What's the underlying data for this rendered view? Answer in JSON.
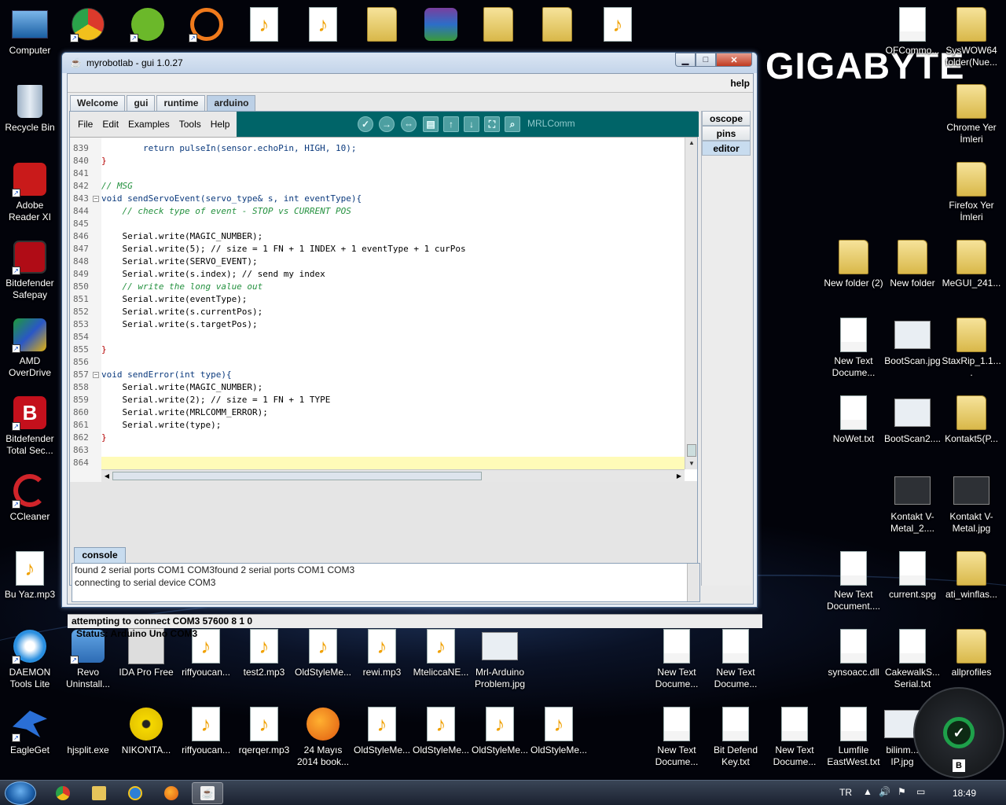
{
  "desktop": {
    "brand": "GIGABYTE",
    "icons_left": [
      {
        "label": "Computer",
        "glyph": "computer-icon"
      },
      {
        "label": "Recycle Bin",
        "glyph": "recycle-bin-icon"
      },
      {
        "label": "Adobe Reader XI",
        "glyph": "adobe-reader-icon"
      },
      {
        "label": "Bitdefender Safepay",
        "glyph": "bitdefender-safepay-icon"
      },
      {
        "label": "AMD OverDrive",
        "glyph": "amd-overdrive-icon"
      },
      {
        "label": "Bitdefender Total Sec...",
        "glyph": "bitdefender-icon"
      },
      {
        "label": "CCleaner",
        "glyph": "ccleaner-icon"
      },
      {
        "label": "Bu Yaz.mp3",
        "glyph": "mp3-icon"
      },
      {
        "label": "DAEMON Tools Lite",
        "glyph": "daemon-tools-icon"
      },
      {
        "label": "EagleGet",
        "glyph": "eagleget-icon"
      }
    ],
    "icons_bottom_row1": [
      {
        "label": "Revo Uninstall..."
      },
      {
        "label": "IDA Pro Free"
      },
      {
        "label": "riffyoucan..."
      },
      {
        "label": "test2.mp3"
      },
      {
        "label": "OldStyleMe..."
      },
      {
        "label": "rewi.mp3"
      },
      {
        "label": "MteliccaNE..."
      },
      {
        "label": "Mrl-Arduino Problem.jpg"
      }
    ],
    "icons_bottom_row2": [
      {
        "label": "hjsplit.exe"
      },
      {
        "label": "NIKONTA..."
      },
      {
        "label": "riffyoucan..."
      },
      {
        "label": "rqerqer.mp3"
      },
      {
        "label": "24 Mayıs 2014 book..."
      },
      {
        "label": "OldStyleMe..."
      },
      {
        "label": "OldStyleMe..."
      },
      {
        "label": "OldStyleMe..."
      },
      {
        "label": "OldStyleMe..."
      }
    ],
    "icons_right": [
      {
        "label": "OFCommo..."
      },
      {
        "label": "SysWOW64 folder(Nue..."
      },
      {
        "label": "Chrome Yer İmleri"
      },
      {
        "label": "Firefox Yer İmleri"
      },
      {
        "label": "New folder (2)"
      },
      {
        "label": "New folder"
      },
      {
        "label": "MeGUI_241..."
      },
      {
        "label": "New Text Docume..."
      },
      {
        "label": "BootScan.jpg"
      },
      {
        "label": "StaxRip_1.1...."
      },
      {
        "label": "NoWet.txt"
      },
      {
        "label": "BootScan2...."
      },
      {
        "label": "Kontakt5(P..."
      },
      {
        "label": "Kontakt V-Metal_2...."
      },
      {
        "label": "Kontakt V-Metal.jpg"
      },
      {
        "label": "New Text Document...."
      },
      {
        "label": "current.spg"
      },
      {
        "label": "ati_winflas..."
      },
      {
        "label": "New Text Docume..."
      },
      {
        "label": "New Text Docume..."
      },
      {
        "label": "synsoacc.dll"
      },
      {
        "label": "CakewalkS... Serial.txt"
      },
      {
        "label": "allprofiles"
      },
      {
        "label": "New Text Docume..."
      },
      {
        "label": "Bit Defend Key.txt"
      },
      {
        "label": "New Text Docume..."
      },
      {
        "label": "Lumfile EastWest.txt"
      },
      {
        "label": "bilinm... IP.jpg"
      }
    ]
  },
  "window": {
    "title": "myrobotlab - gui 1.0.27",
    "buttons": {
      "min": "▁",
      "max": "□",
      "close": "✕"
    },
    "help_label": "help",
    "tabs": [
      "Welcome",
      "gui",
      "runtime",
      "arduino"
    ],
    "active_tab": "arduino",
    "side_tabs": [
      "oscope",
      "pins",
      "editor"
    ],
    "active_side_tab": "editor",
    "menu": [
      "File",
      "Edit",
      "Examples",
      "Tools",
      "Help"
    ],
    "toolbar_title": "MRLComm",
    "toolbar_icons": [
      "verify-icon",
      "upload-icon",
      "new-icon",
      "open-icon",
      "save-icon",
      "export-icon",
      "fullscreen-icon",
      "serial-monitor-icon"
    ],
    "code_lines": [
      {
        "num": "839",
        "text": "        return pulseIn(sensor.echoPin, HIGH, 10);",
        "cls": "kw"
      },
      {
        "num": "840",
        "text": "}",
        "cls": "br"
      },
      {
        "num": "841",
        "text": "",
        "cls": ""
      },
      {
        "num": "842",
        "text": "// MSG",
        "cls": "cm"
      },
      {
        "num": "843",
        "text": "void sendServoEvent(servo_type& s, int eventType){",
        "cls": "kw",
        "fold": "−"
      },
      {
        "num": "844",
        "text": "    // check type of event - STOP vs CURRENT POS",
        "cls": "cm"
      },
      {
        "num": "845",
        "text": "",
        "cls": ""
      },
      {
        "num": "846",
        "text": "    Serial.write(MAGIC_NUMBER);",
        "cls": ""
      },
      {
        "num": "847",
        "text": "    Serial.write(5); // size = 1 FN + 1 INDEX + 1 eventType + 1 curPos",
        "cls": ""
      },
      {
        "num": "848",
        "text": "    Serial.write(SERVO_EVENT);",
        "cls": ""
      },
      {
        "num": "849",
        "text": "    Serial.write(s.index); // send my index",
        "cls": ""
      },
      {
        "num": "850",
        "text": "    // write the long value out",
        "cls": "cm"
      },
      {
        "num": "851",
        "text": "    Serial.write(eventType);",
        "cls": ""
      },
      {
        "num": "852",
        "text": "    Serial.write(s.currentPos);",
        "cls": ""
      },
      {
        "num": "853",
        "text": "    Serial.write(s.targetPos);",
        "cls": ""
      },
      {
        "num": "854",
        "text": "",
        "cls": ""
      },
      {
        "num": "855",
        "text": "}",
        "cls": "br"
      },
      {
        "num": "856",
        "text": "",
        "cls": ""
      },
      {
        "num": "857",
        "text": "void sendError(int type){",
        "cls": "kw",
        "fold": "−"
      },
      {
        "num": "858",
        "text": "    Serial.write(MAGIC_NUMBER);",
        "cls": ""
      },
      {
        "num": "859",
        "text": "    Serial.write(2); // size = 1 FN + 1 TYPE",
        "cls": ""
      },
      {
        "num": "860",
        "text": "    Serial.write(MRLCOMM_ERROR);",
        "cls": ""
      },
      {
        "num": "861",
        "text": "    Serial.write(type);",
        "cls": ""
      },
      {
        "num": "862",
        "text": "}",
        "cls": "br"
      },
      {
        "num": "863",
        "text": "",
        "cls": ""
      },
      {
        "num": "864",
        "text": "",
        "cls": ""
      }
    ],
    "console_tab": "console",
    "console_lines": [
      "found 2 serial ports COM1 COM3found 2 serial ports COM1 COM3",
      "connecting to serial device COM3"
    ],
    "status": "Status:  Arduino Uno COM3",
    "bottom_status": "attempting to connect COM3 57600 8 1 0"
  },
  "taskbar": {
    "apps": [
      "chrome-icon",
      "explorer-icon",
      "ie-icon",
      "firefox-icon",
      "java-icon"
    ],
    "tray": {
      "lang": "TR",
      "clock": "18:49"
    }
  }
}
